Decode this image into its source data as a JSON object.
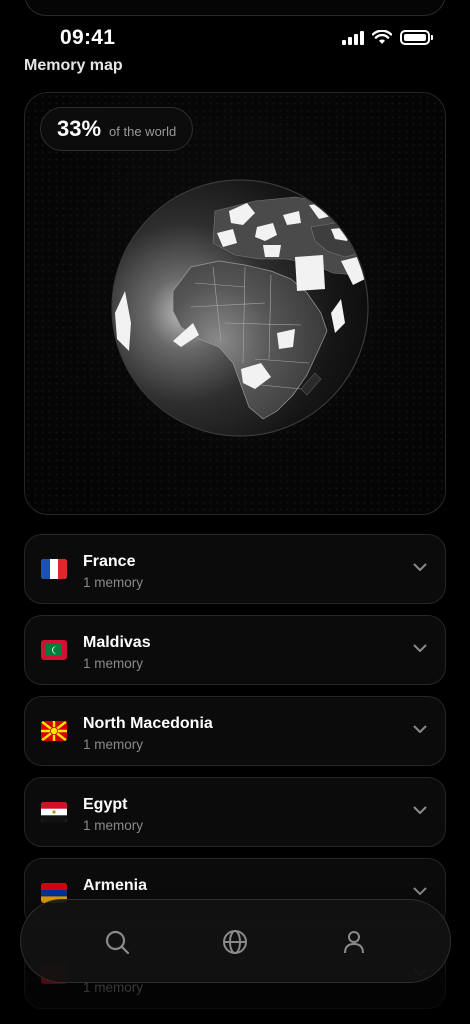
{
  "status_bar": {
    "time": "09:41"
  },
  "header": {
    "title": "Memory map"
  },
  "map": {
    "coverage_percent": "33%",
    "coverage_label": "of the world"
  },
  "countries": [
    {
      "name": "France",
      "memories": "1 memory",
      "flag": "france"
    },
    {
      "name": "Maldivas",
      "memories": "1 memory",
      "flag": "maldives"
    },
    {
      "name": "North Macedonia",
      "memories": "1 memory",
      "flag": "north-macedonia"
    },
    {
      "name": "Egypt",
      "memories": "1 memory",
      "flag": "egypt"
    },
    {
      "name": "Armenia",
      "memories": "",
      "flag": "armenia"
    },
    {
      "name": "",
      "memories": "1 memory",
      "flag": "unknown"
    }
  ],
  "tab_bar": {
    "items": [
      "search-icon",
      "globe-icon",
      "profile-icon"
    ],
    "active": "globe-icon"
  }
}
